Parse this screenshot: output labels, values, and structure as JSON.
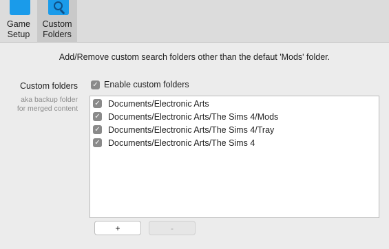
{
  "toolbar": {
    "items": [
      {
        "label_line1": "Game",
        "label_line2": "Setup",
        "icon": "folder-icon"
      },
      {
        "label_line1": "Custom",
        "label_line2": "Folders",
        "icon": "folder-search-icon",
        "selected": true
      }
    ]
  },
  "description": "Add/Remove custom search folders other than the defaut 'Mods' folder.",
  "custom_folders": {
    "label": "Custom folders",
    "hint_line1": "aka backup folder",
    "hint_line2": "for merged content",
    "enable_label": "Enable custom folders",
    "enable_checked": true,
    "items": [
      {
        "path": "Documents/Electronic Arts",
        "checked": true
      },
      {
        "path": "Documents/Electronic Arts/The Sims 4/Mods",
        "checked": true
      },
      {
        "path": "Documents/Electronic Arts/The Sims 4/Tray",
        "checked": true
      },
      {
        "path": "Documents/Electronic Arts/The Sims 4",
        "checked": true
      }
    ]
  },
  "buttons": {
    "add_label": "+",
    "remove_label": "-"
  },
  "colors": {
    "accent_folder": "#1a9bea",
    "checkbox_fill": "#8a8a8a",
    "toolbar_bg": "#dcdcdc",
    "window_bg": "#ececec"
  },
  "glyphs": {
    "check": "✓"
  }
}
